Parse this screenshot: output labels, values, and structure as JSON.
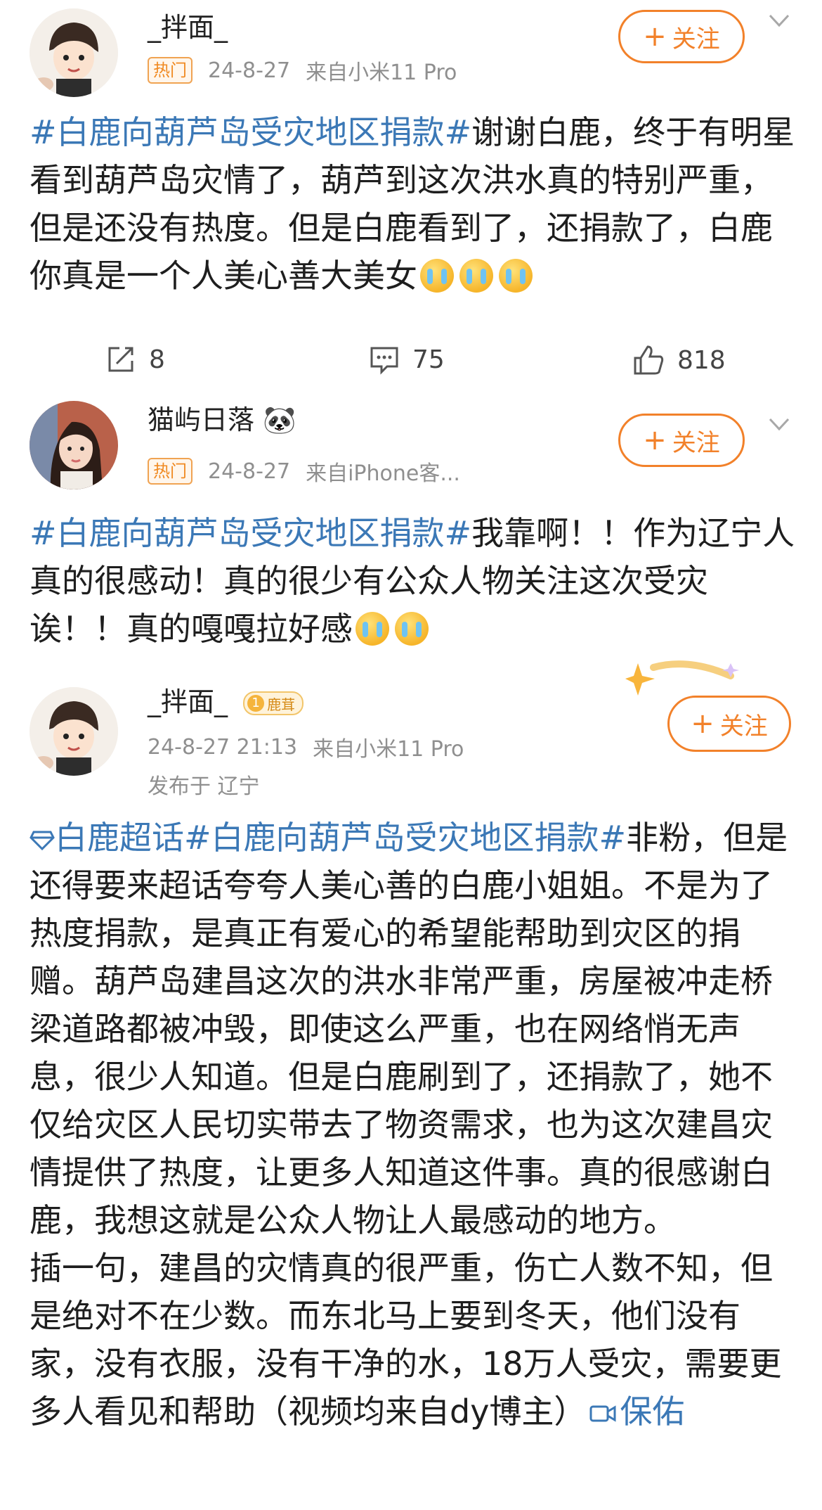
{
  "posts": [
    {
      "username": "_拌面_",
      "hot_label": "热门",
      "date": "24-8-27",
      "source_prefix": "来自",
      "source": "小米11 Pro",
      "follow_label": "关注",
      "hashtag": "#白鹿向葫芦岛受灾地区捐款#",
      "text": "谢谢白鹿，终于有明星看到葫芦岛灾情了，葫芦到这次洪水真的特别严重，但是还没有热度。但是白鹿看到了，还捐款了，白鹿你真是一个人美心善大美女",
      "emoji_count": 3,
      "actions": {
        "repost_count": "8",
        "comment_count": "75",
        "like_count": "818"
      }
    },
    {
      "username": "猫屿日落",
      "username_emoji": "🐼",
      "hot_label": "热门",
      "date": "24-8-27",
      "source_prefix": "来自",
      "source": "iPhone客...",
      "follow_label": "关注",
      "hashtag": "#白鹿向葫芦岛受灾地区捐款#",
      "text": "我靠啊！！作为辽宁人真的很感动！真的很少有公众人物关注这次受灾诶！！真的嘎嘎拉好感",
      "emoji_count": 2
    },
    {
      "username": "_拌面_",
      "level_number": "1",
      "level_label": "鹿茸",
      "datetime": "24-8-27 21:13",
      "source_prefix": "来自",
      "source": "小米11 Pro",
      "location": "发布于 辽宁",
      "follow_label": "关注",
      "supertopic": "白鹿超话",
      "hashtag": "#白鹿向葫芦岛受灾地区捐款#",
      "paragraph1": "非粉，但是还得要来超话夸夸人美心善的白鹿小姐姐。不是为了热度捐款，是真正有爱心的希望能帮助到灾区的捐赠。葫芦岛建昌这次的洪水非常严重，房屋被冲走桥梁道路都被冲毁，即使这么严重，也在网络悄无声息，很少人知道。但是白鹿刷到了，还捐款了，她不仅给灾区人民切实带去了物资需求，也为这次建昌灾情提供了热度，让更多人知道这件事。真的很感谢白鹿，我想这就是公众人物让人最感动的地方。",
      "paragraph2": "插一句，建昌的灾情真的很严重，伤亡人数不知，但是绝对不在少数。而东北马上要到冬天，他们没有家，没有衣服，没有干净的水，18万人受灾，需要更多人看见和帮助（视频均来自dy博主）",
      "video_link": "保佑"
    }
  ],
  "colors": {
    "hashtag": "#3b78b6",
    "follow": "#f2812a",
    "meta": "#8f8f8f",
    "hot_badge": "#f08a22"
  }
}
